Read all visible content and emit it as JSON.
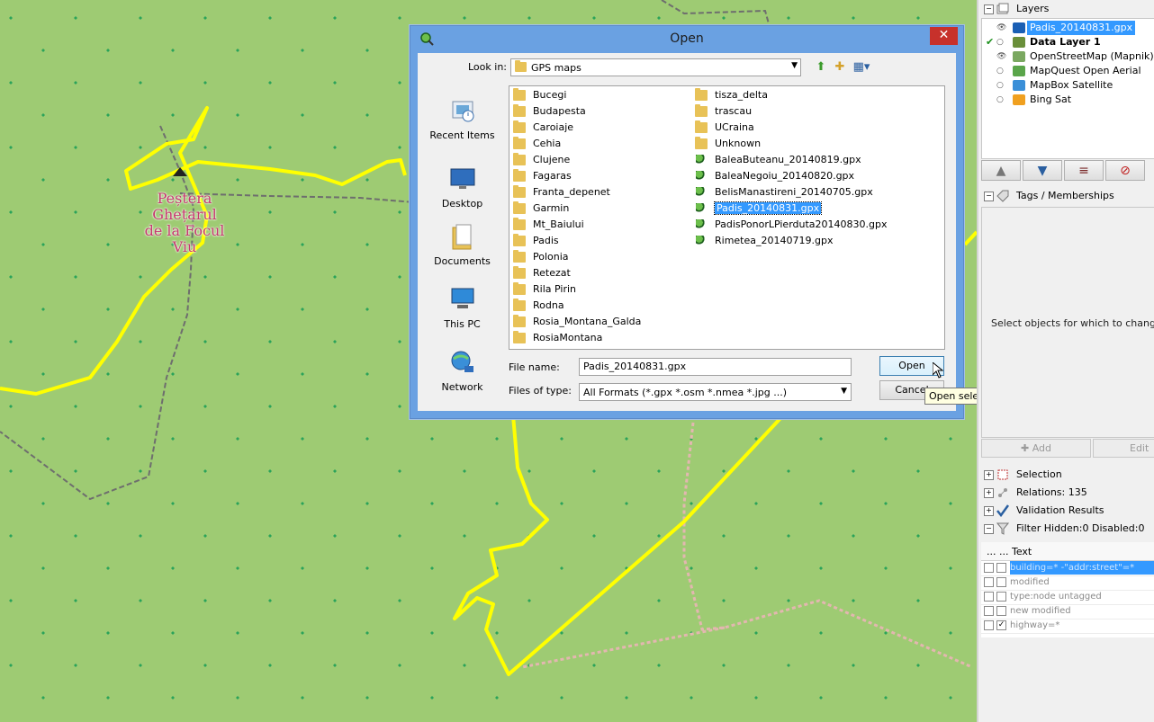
{
  "map": {
    "poi_label_lines": [
      "Peștera",
      "Ghețarul",
      "de la Focul",
      "Viu"
    ],
    "track_color": "#ffff00",
    "background_color": "#9ecb73"
  },
  "dialog": {
    "title": "Open",
    "close_symbol": "✕",
    "look_in_label": "Look in:",
    "look_in_value": "GPS maps",
    "places": [
      {
        "label": "Recent Items",
        "icon": "recent-items-icon"
      },
      {
        "label": "Desktop",
        "icon": "desktop-icon"
      },
      {
        "label": "Documents",
        "icon": "documents-icon"
      },
      {
        "label": "This PC",
        "icon": "this-pc-icon"
      },
      {
        "label": "Network",
        "icon": "network-icon"
      }
    ],
    "folders_col1": [
      "Bucegi",
      "Budapesta",
      "Caroiaje",
      "Cehia",
      "Clujene",
      "Fagaras",
      "Franta_depenet",
      "Garmin",
      "Mt_Baiului",
      "Padis",
      "Polonia",
      "Retezat",
      "Rila Pirin",
      "Rodna",
      "Rosia_Montana_Galda",
      "RosiaMontana"
    ],
    "folders_col2": [
      "tisza_delta",
      "trascau",
      "UCraina",
      "Unknown"
    ],
    "files": [
      "BaleaButeanu_20140819.gpx",
      "BaleaNegoiu_20140820.gpx",
      "BelisManastireni_20140705.gpx",
      "Padis_20140831.gpx",
      "PadisPonorLPierduta20140830.gpx",
      "Rimetea_20140719.gpx"
    ],
    "selected_file": "Padis_20140831.gpx",
    "file_name_label": "File name:",
    "file_name_value": "Padis_20140831.gpx",
    "file_type_label": "Files of type:",
    "file_type_value": "All Formats (*.gpx *.osm *.nmea *.jpg ...)",
    "open_button": "Open",
    "cancel_button": "Cancel",
    "tooltip": "Open selected file"
  },
  "panel": {
    "layers_title": "Layers",
    "layers": [
      {
        "name": "Padis_20140831.gpx",
        "icon": "gpx-layer-icon",
        "color": "#1a5fb4",
        "selected": true,
        "visible": true,
        "active": false,
        "bold": false
      },
      {
        "name": "Data Layer 1",
        "icon": "data-layer-icon",
        "color": "#6a8f3a",
        "selected": false,
        "visible": false,
        "active": true,
        "bold": true
      },
      {
        "name": "OpenStreetMap (Mapnik)",
        "icon": "imagery-layer-icon",
        "color": "#7aa860",
        "selected": false,
        "visible": true,
        "active": false,
        "bold": false
      },
      {
        "name": "MapQuest Open Aerial",
        "icon": "imagery-layer-icon",
        "color": "#5aa54a",
        "selected": false,
        "visible": false,
        "active": false,
        "bold": false
      },
      {
        "name": "MapBox Satellite",
        "icon": "imagery-layer-icon",
        "color": "#3a8fd8",
        "selected": false,
        "visible": false,
        "active": false,
        "bold": false
      },
      {
        "name": "Bing Sat",
        "icon": "imagery-layer-icon",
        "color": "#f0a020",
        "selected": false,
        "visible": false,
        "active": false,
        "bold": false
      }
    ],
    "layer_buttons": [
      "▲",
      "▼",
      "merge",
      "delete"
    ],
    "tags_title": "Tags / Memberships",
    "tags_message": "Select objects for which to change tags.",
    "tags_add": "Add",
    "tags_edit": "Edit",
    "selection_title": "Selection",
    "relations_title": "Relations: 135",
    "validation_title": "Validation Results",
    "filter_title": "Filter Hidden:0 Disabled:0",
    "filter_col_dots": "... ...",
    "filter_col_text": "Text",
    "filter_rules": [
      {
        "text": "building=* -\"addr:street\"=*",
        "selected": true,
        "checked": false
      },
      {
        "text": "modified",
        "selected": false,
        "checked": false
      },
      {
        "text": "type:node untagged",
        "selected": false,
        "checked": false
      },
      {
        "text": "new modified",
        "selected": false,
        "checked": false
      },
      {
        "text": "highway=*",
        "selected": false,
        "checked": true
      }
    ]
  }
}
